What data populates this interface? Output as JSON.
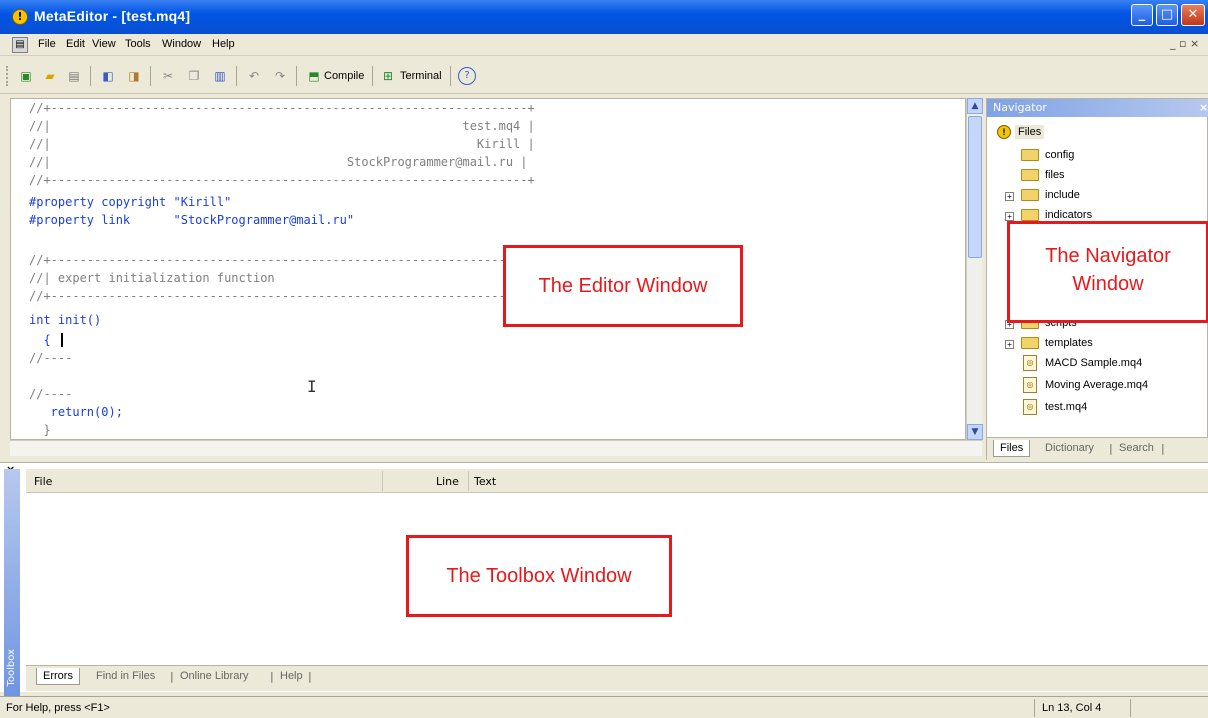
{
  "window": {
    "title": "MetaEditor - [test.mq4]"
  },
  "menu": {
    "items": [
      "File",
      "Edit",
      "View",
      "Tools",
      "Window",
      "Help"
    ]
  },
  "toolbar": {
    "compile_label": "Compile",
    "terminal_label": "Terminal"
  },
  "editor": {
    "lines": [
      "//+------------------------------------------------------------------+",
      "//|                                                         test.mq4 |",
      "//|                                                           Kirill |",
      "//|                                         StockProgrammer@mail.ru |",
      "//+------------------------------------------------------------------+",
      "#property copyright \"Kirill\"",
      "#property link      \"StockProgrammer@mail.ru\"",
      "",
      "//+------------------------------------------------------------------+",
      "//| expert initialization function                                   |",
      "//+------------------------------------------------------------------+",
      "int init()",
      "  {",
      "//----",
      "",
      "//----",
      "   return(0);",
      "  }"
    ]
  },
  "navigator": {
    "title": "Navigator",
    "root": "Files",
    "items": [
      {
        "label": "config",
        "type": "folder",
        "expandable": false
      },
      {
        "label": "files",
        "type": "folder",
        "expandable": false
      },
      {
        "label": "include",
        "type": "folder",
        "expandable": true
      },
      {
        "label": "indicators",
        "type": "folder",
        "expandable": true
      },
      {
        "label": "scripts",
        "type": "folder",
        "expandable": true
      },
      {
        "label": "templates",
        "type": "folder",
        "expandable": true
      },
      {
        "label": "MACD Sample.mq4",
        "type": "file"
      },
      {
        "label": "Moving Average.mq4",
        "type": "file"
      },
      {
        "label": "test.mq4",
        "type": "file"
      }
    ],
    "tabs": [
      "Files",
      "Dictionary",
      "Search"
    ]
  },
  "toolbox": {
    "columns": [
      "File",
      "Line",
      "Text"
    ],
    "side_label": "Toolbox",
    "tabs": [
      "Errors",
      "Find in Files",
      "Online Library",
      "Help"
    ]
  },
  "annotations": {
    "editor": "The Editor Window",
    "navigator": "The Navigator\nWindow",
    "toolbox": "The Toolbox Window"
  },
  "status": {
    "help": "For Help, press <F1>",
    "position": "Ln 13, Col 4"
  }
}
